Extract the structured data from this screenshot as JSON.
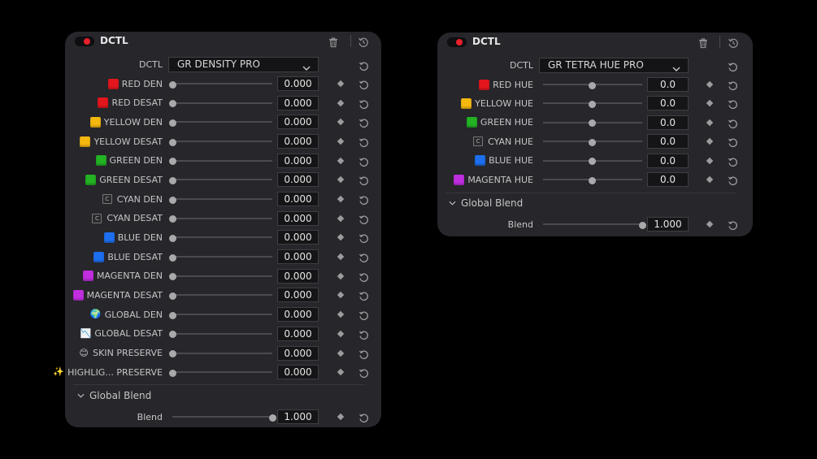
{
  "left_panel": {
    "title": "DCTL",
    "dctl_label": "DCTL",
    "dctl_value": "GR DENSITY PRO",
    "rows": [
      {
        "label": "RED DEN",
        "value": "0.000",
        "swatch": "#e3161d",
        "swatch_type": "color"
      },
      {
        "label": "RED DESAT",
        "value": "0.000",
        "swatch": "#e3161d",
        "swatch_type": "color"
      },
      {
        "label": "YELLOW DEN",
        "value": "0.000",
        "swatch": "#f5b80f",
        "swatch_type": "color"
      },
      {
        "label": "YELLOW DESAT",
        "value": "0.000",
        "swatch": "#f5b80f",
        "swatch_type": "color"
      },
      {
        "label": "GREEN DEN",
        "value": "0.000",
        "swatch": "#23b323",
        "swatch_type": "color"
      },
      {
        "label": "GREEN DESAT",
        "value": "0.000",
        "swatch": "#23b323",
        "swatch_type": "color"
      },
      {
        "label": "CYAN DEN",
        "value": "0.000",
        "swatch": "C",
        "swatch_type": "letter"
      },
      {
        "label": "CYAN DESAT",
        "value": "0.000",
        "swatch": "C",
        "swatch_type": "letter"
      },
      {
        "label": "BLUE DEN",
        "value": "0.000",
        "swatch": "#1d6ff0",
        "swatch_type": "color"
      },
      {
        "label": "BLUE DESAT",
        "value": "0.000",
        "swatch": "#1d6ff0",
        "swatch_type": "color"
      },
      {
        "label": "MAGENTA DEN",
        "value": "0.000",
        "swatch": "#c12ee0",
        "swatch_type": "color"
      },
      {
        "label": "MAGENTA DESAT",
        "value": "0.000",
        "swatch": "#c12ee0",
        "swatch_type": "color"
      },
      {
        "label": "GLOBAL DEN",
        "value": "0.000",
        "swatch": "🌍",
        "swatch_type": "emoji"
      },
      {
        "label": "GLOBAL DESAT",
        "value": "0.000",
        "swatch": "📉",
        "swatch_type": "emoji"
      },
      {
        "label": "SKIN PRESERVE",
        "value": "0.000",
        "swatch": "😊",
        "swatch_type": "emoji"
      },
      {
        "label": "HIGHLIG... PRESERVE",
        "value": "0.000",
        "swatch": "✨",
        "swatch_type": "emoji"
      }
    ],
    "global_blend": {
      "section": "Global Blend",
      "label": "Blend",
      "value": "1.000",
      "level": 1.0
    }
  },
  "right_panel": {
    "title": "DCTL",
    "dctl_label": "DCTL",
    "dctl_value": "GR TETRA HUE PRO",
    "rows": [
      {
        "label": "RED HUE",
        "value": "0.0",
        "swatch": "#e3161d",
        "swatch_type": "color"
      },
      {
        "label": "YELLOW HUE",
        "value": "0.0",
        "swatch": "#f5b80f",
        "swatch_type": "color"
      },
      {
        "label": "GREEN HUE",
        "value": "0.0",
        "swatch": "#23b323",
        "swatch_type": "color"
      },
      {
        "label": "CYAN HUE",
        "value": "0.0",
        "swatch": "C",
        "swatch_type": "letter"
      },
      {
        "label": "BLUE HUE",
        "value": "0.0",
        "swatch": "#1d6ff0",
        "swatch_type": "color"
      },
      {
        "label": "MAGENTA HUE",
        "value": "0.0",
        "swatch": "#c12ee0",
        "swatch_type": "color"
      }
    ],
    "global_blend": {
      "section": "Global Blend",
      "label": "Blend",
      "value": "1.000",
      "level": 1.0
    }
  },
  "icons": {
    "toggle": "power-toggle-icon",
    "delete": "trash-icon",
    "reset_all": "reset-all-icon",
    "keyframe": "keyframe-diamond-icon",
    "reset": "reset-icon",
    "dropdown": "chevron-down-icon",
    "collapse": "chevron-down-icon"
  },
  "colors": {
    "panel": "#26262b",
    "background": "#000000",
    "toggle_on": "#e8202a",
    "field": "#151517"
  }
}
